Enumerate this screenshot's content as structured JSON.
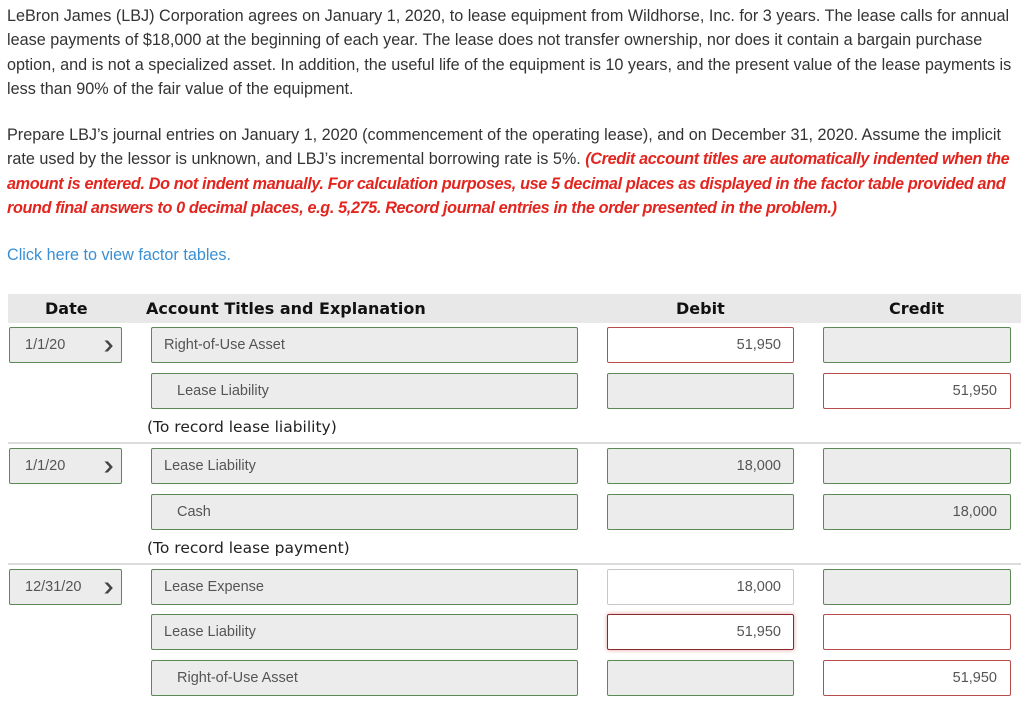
{
  "problem": {
    "paragraph1": "LeBron James (LBJ) Corporation agrees on January 1, 2020, to lease equipment from Wildhorse, Inc. for 3 years. The lease calls for annual lease payments of $18,000 at the beginning of each year. The lease does not transfer ownership, nor does it contain a bargain purchase option, and is not a specialized asset. In addition, the useful life of the equipment is 10 years, and the present value of the lease payments is less than 90% of the fair value of the equipment.",
    "paragraph2": "Prepare LBJ’s journal entries on January 1, 2020 (commencement of the operating lease), and on December 31, 2020. Assume the implicit rate used by the lessor is unknown, and LBJ’s incremental borrowing rate is 5%.",
    "instructions": "(Credit account titles are automatically indented when the amount is entered. Do not indent manually. For calculation purposes, use 5 decimal places as displayed in the factor table provided and round final answers to 0 decimal places, e.g. 5,275. Record journal entries in the order presented in the problem.)",
    "factor_link": "Click here to view factor tables."
  },
  "table": {
    "headers": {
      "date": "Date",
      "account": "Account Titles and Explanation",
      "debit": "Debit",
      "credit": "Credit"
    },
    "entries": [
      {
        "date": "1/1/20",
        "lines": [
          {
            "account": "Right-of-Use Asset",
            "debit": "51,950",
            "credit": ""
          },
          {
            "account": "Lease Liability",
            "debit": "",
            "credit": "51,950"
          }
        ],
        "explanation": "(To record lease liability)"
      },
      {
        "date": "1/1/20",
        "lines": [
          {
            "account": "Lease Liability",
            "debit": "18,000",
            "credit": ""
          },
          {
            "account": "Cash",
            "debit": "",
            "credit": "18,000"
          }
        ],
        "explanation": "(To record lease payment)"
      },
      {
        "date": "12/31/20",
        "lines": [
          {
            "account": "Lease Expense",
            "debit": "18,000",
            "credit": ""
          },
          {
            "account": "Lease Liability",
            "debit": "51,950",
            "credit": ""
          },
          {
            "account": "Right-of-Use Asset",
            "debit": "",
            "credit": "51,950"
          }
        ],
        "explanation": ""
      }
    ]
  },
  "icons": {
    "dropdown": "chevron-down-icon"
  },
  "colors": {
    "instruction_red": "#e3251f",
    "link_blue": "#3a8fd4",
    "correct_border": "#5c8a57",
    "error_border": "#b64c4c"
  }
}
